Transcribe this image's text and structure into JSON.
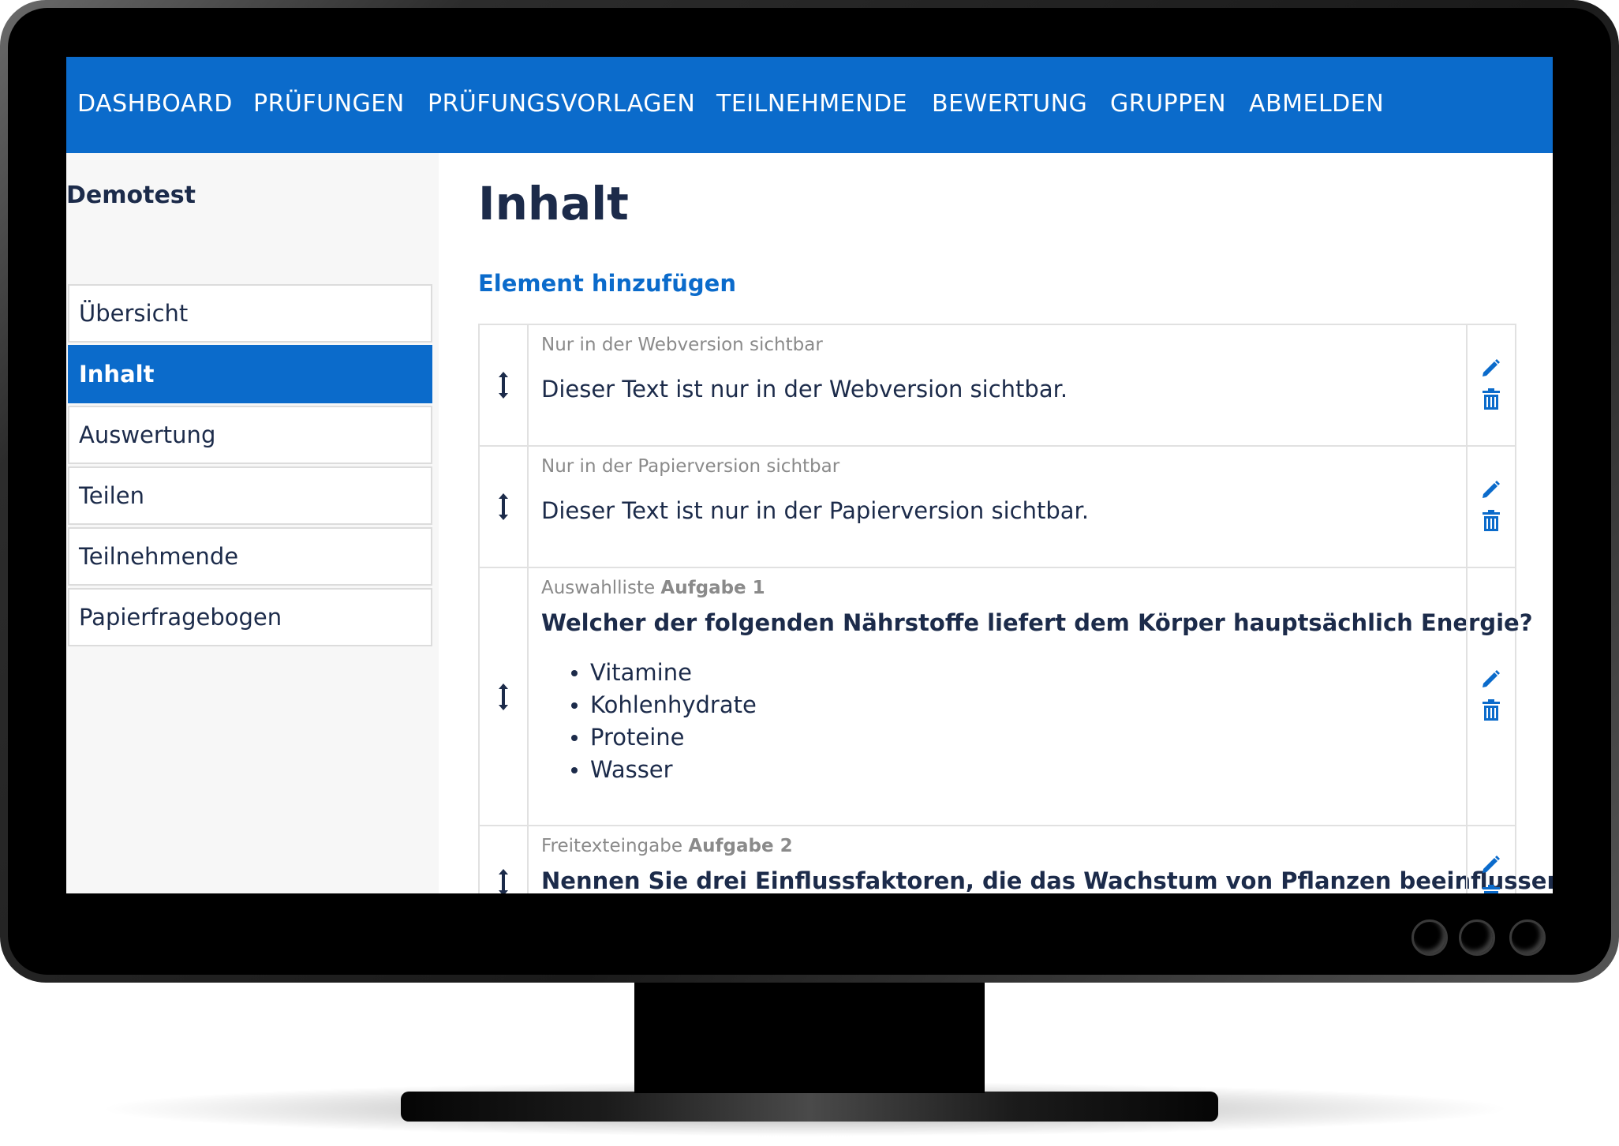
{
  "nav": {
    "items": [
      "DASHBOARD",
      "PRÜFUNGEN",
      "PRÜFUNGSVORLAGEN",
      "TEILNEHMENDE",
      "BEWERTUNG",
      "GRUPPEN",
      "ABMELDEN"
    ]
  },
  "sidebar": {
    "title": "Demotest",
    "items": [
      "Übersicht",
      "Inhalt",
      "Auswertung",
      "Teilen",
      "Teilnehmende",
      "Papierfragebogen"
    ],
    "active": "Inhalt"
  },
  "main": {
    "title": "Inhalt",
    "add_label": "Element hinzufügen",
    "items": [
      {
        "type": "Nur in der Webversion sichtbar",
        "text": "Dieser Text ist nur in der Webversion sichtbar."
      },
      {
        "type": "Nur in der Papierversion sichtbar",
        "text": "Dieser Text ist nur in der Papierversion sichtbar."
      },
      {
        "type": "Auswahlliste",
        "task": "Aufgabe 1",
        "question": "Welcher der folgenden Nährstoffe liefert dem Körper hauptsächlich Energie?",
        "options": [
          "Vitamine",
          "Kohlenhydrate",
          "Proteine",
          "Wasser"
        ]
      },
      {
        "type": "Freitexteingabe",
        "task": "Aufgabe 2",
        "question": "Nennen Sie drei Einflussfaktoren, die das Wachstum von Pflanzen beeinflussen,"
      }
    ]
  },
  "icons": {
    "drag": "drag-handle-icon",
    "edit": "pencil-icon",
    "delete": "trash-icon"
  },
  "colors": {
    "primary": "#0b6bcb",
    "text": "#1c2b4a",
    "muted": "#8a8a8a",
    "sidebar_bg": "#f7f7f7"
  }
}
